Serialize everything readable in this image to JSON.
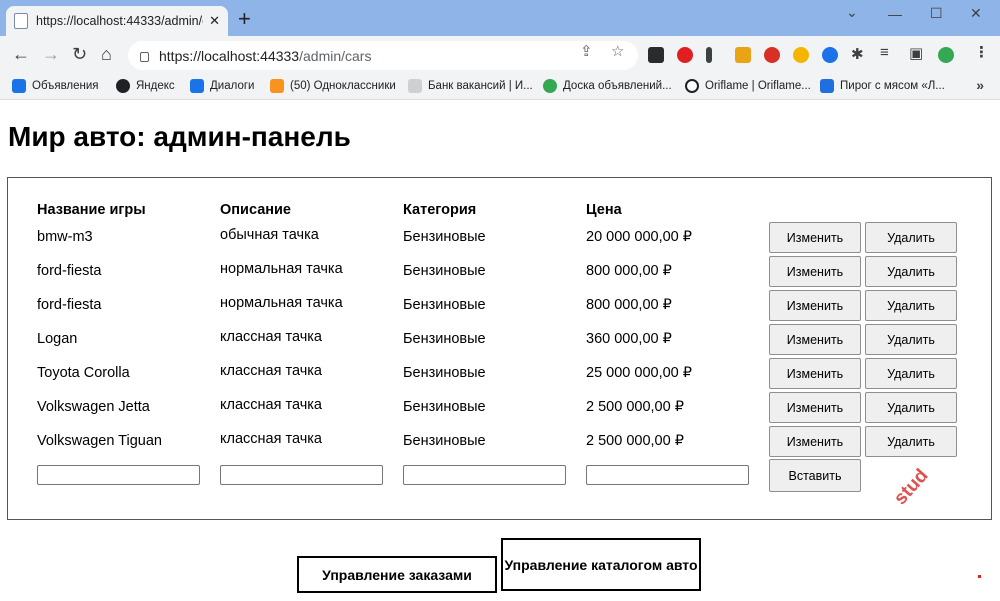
{
  "browser": {
    "tab_title": "https://localhost:44333/admin/cars",
    "url_host": "https://localhost:44333",
    "url_path": "/admin/cars",
    "bookmarks": [
      {
        "label": "Объявления",
        "color": "#1a73e8"
      },
      {
        "label": "Яндекс",
        "color": "#202124"
      },
      {
        "label": "Диалоги",
        "color": "#1a73e8"
      },
      {
        "label": "(50) Одноклассники",
        "color": "#f7931e"
      },
      {
        "label": "Банк вакансий | И...",
        "color": "#d0d0d0"
      },
      {
        "label": "Доска объявлений...",
        "color": "#34a853"
      },
      {
        "label": "Oriflame | Oriflame...",
        "color": "#202124"
      },
      {
        "label": "Пирог с мясом «Л...",
        "color": "#1f6fe0"
      }
    ]
  },
  "page": {
    "title": "Мир авто: админ-панель",
    "columns": [
      "Название игры",
      "Описание",
      "Категория",
      "Цена"
    ],
    "rows": [
      {
        "name": "bmw-m3",
        "desc": "обычная тачка",
        "category": "Бензиновые",
        "price": "20 000 000,00 ₽"
      },
      {
        "name": "ford-fiesta",
        "desc": "нормальная тачка",
        "category": "Бензиновые",
        "price": "800 000,00 ₽"
      },
      {
        "name": "ford-fiesta",
        "desc": "нормальная тачка",
        "category": "Бензиновые",
        "price": "800 000,00 ₽"
      },
      {
        "name": "Logan",
        "desc": "классная тачка",
        "category": "Бензиновые",
        "price": "360 000,00 ₽"
      },
      {
        "name": "Toyota Corolla",
        "desc": "классная тачка",
        "category": "Бензиновые",
        "price": "25 000 000,00 ₽"
      },
      {
        "name": "Volkswagen Jetta",
        "desc": "классная тачка",
        "category": "Бензиновые",
        "price": "2 500 000,00 ₽"
      },
      {
        "name": "Volkswagen Tiguan",
        "desc": "классная тачка",
        "category": "Бензиновые",
        "price": "2 500 000,00 ₽"
      }
    ],
    "edit_label": "Изменить",
    "delete_label": "Удалить",
    "insert_label": "Вставить",
    "watermark": "stud",
    "nav_orders": "Управление заказами",
    "nav_catalog": "Управление каталогом авто"
  }
}
